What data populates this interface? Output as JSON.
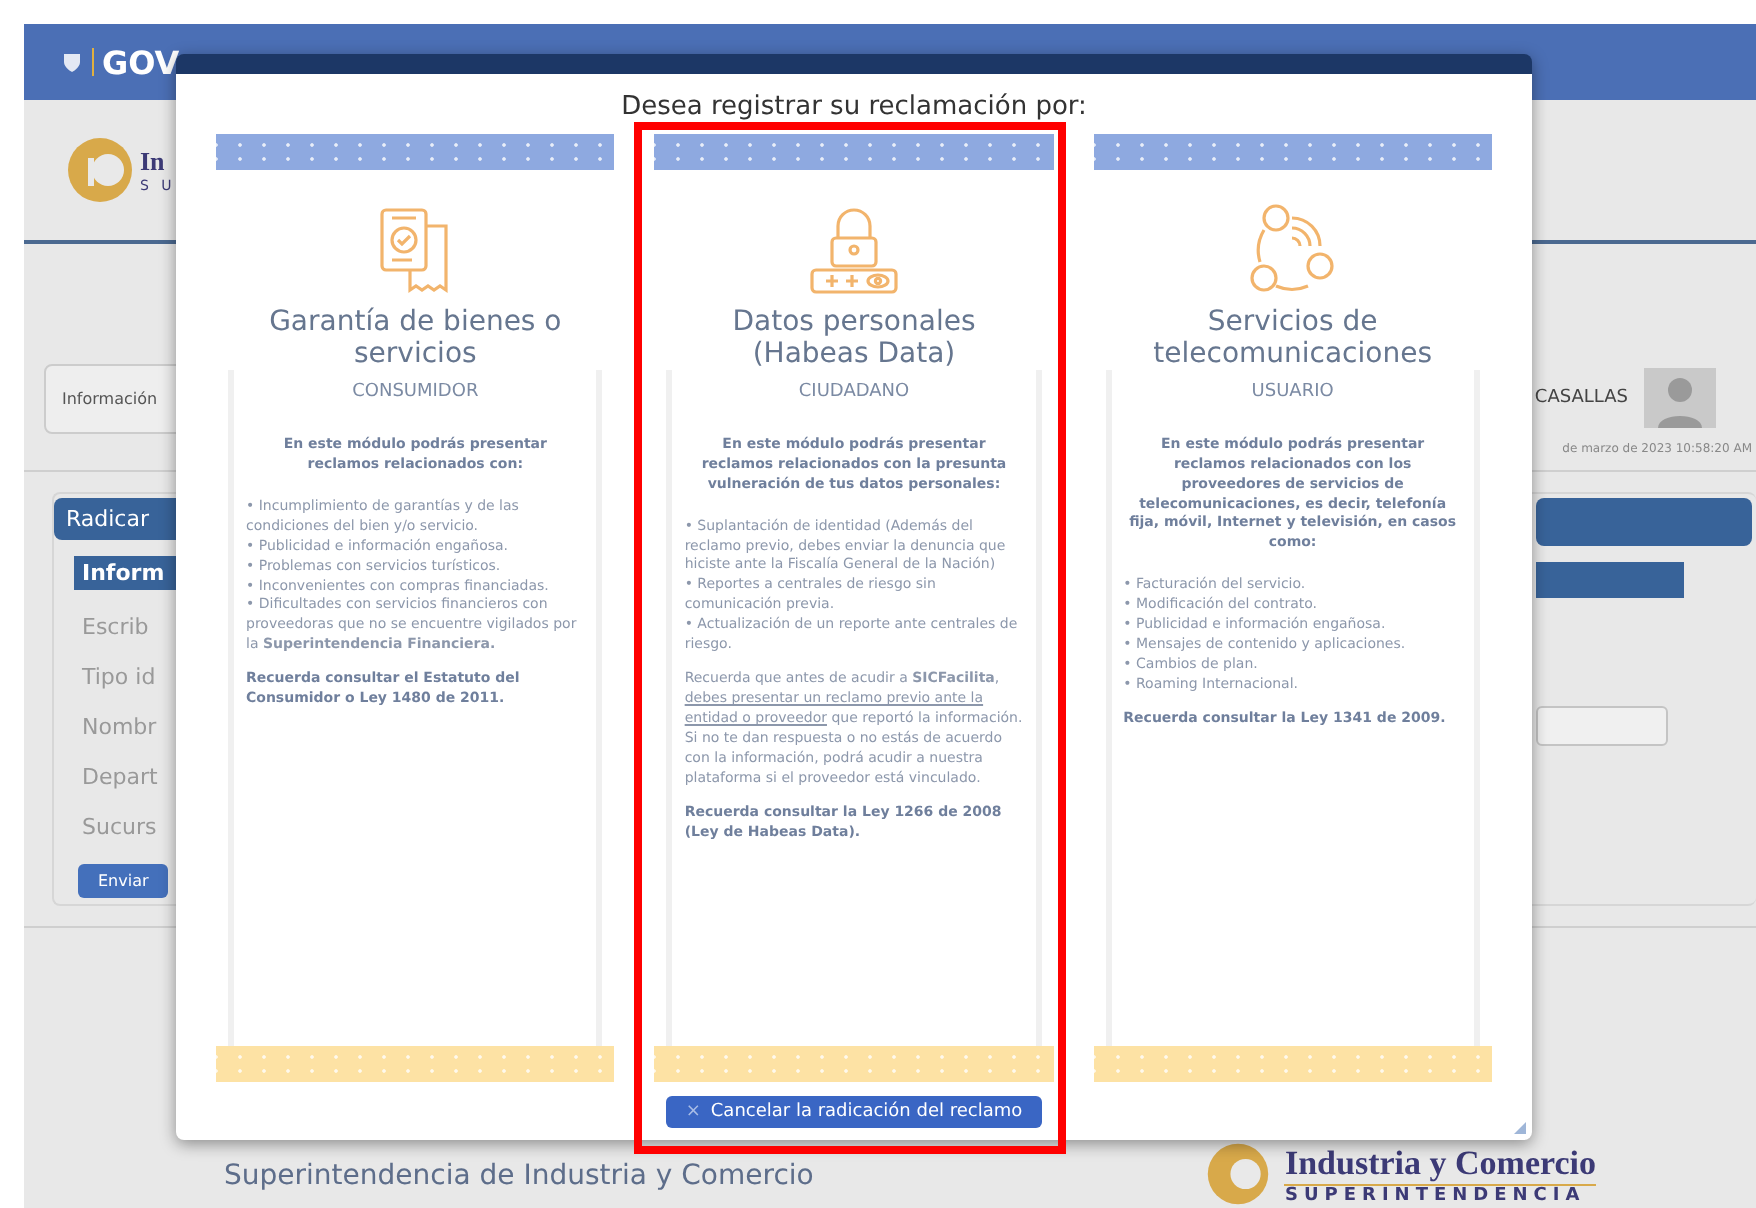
{
  "background": {
    "brand": "GOV",
    "logo": {
      "line1": "In",
      "line2": "S U"
    },
    "info_tab": "Información",
    "user": {
      "name": "CASALLAS",
      "date": "de marzo de 2023 10:58:20 AM"
    },
    "form": {
      "title": "Radicar",
      "section": "Inform",
      "fields": [
        "Escrib",
        "Tipo id",
        "Nombr",
        "Depart",
        "Sucurs"
      ],
      "submit": "Enviar"
    },
    "footer": {
      "text": "Superintendencia de Industria y Comercio",
      "logo_line1": "Industria y Comercio",
      "logo_line2": "SUPERINTENDENCIA"
    }
  },
  "modal": {
    "title": "Desea registrar su reclamación por:",
    "cards": [
      {
        "title": "Garantía de bienes o servicios",
        "role": "CONSUMIDOR",
        "highlighted": false,
        "intro": "En este módulo podrás presentar reclamos relacionados con:",
        "items": [
          "• Incumplimiento de garantías y de las condiciones del bien y/o servicio.",
          "• Publicidad e información engañosa.",
          "• Problemas con servicios turísticos.",
          "• Inconvenientes con compras financiadas.",
          "• Dificultades con servicios financieros con proveedoras que no se encuentre vigilados por la **Superintendencia Financiera.**"
        ],
        "footnote": "Recuerda consultar el Estatuto del Consumidor o Ley 1480 de 2011."
      },
      {
        "title": "Datos personales (Habeas Data)",
        "role": "CIUDADANO",
        "highlighted": true,
        "intro": "En este módulo podrás presentar reclamos relacionados con la presunta vulneración de tus datos personales:",
        "items": [
          "• Suplantación de identidad (Además del reclamo previo, debes enviar la denuncia que hiciste ante la Fiscalía General de la Nación)",
          "• Reportes a centrales de riesgo sin comunicación previa.",
          "• Actualización de un reporte ante centrales de riesgo."
        ],
        "notes": [
          {
            "before": "Recuerda que antes de acudir a **SICFacilita**,",
            "underlined": "debes presentar un reclamo previo ante la entidad o proveedor",
            "after": "que reportó la información. Si no te dan respuesta o no estás de acuerdo con la información, podrá acudir a nuestra plataforma si el proveedor está vinculado."
          }
        ],
        "footnote": "Recuerda consultar la Ley 1266 de 2008 (Ley de Habeas Data)."
      },
      {
        "title": "Servicios de telecomunicaciones",
        "role": "USUARIO",
        "highlighted": false,
        "intro": "En este módulo podrás presentar reclamos relacionados con los proveedores de servicios de telecomunicaciones, es decir, telefonía fija, móvil, Internet y televisión, en casos como:",
        "items": [
          "• Facturación del servicio.",
          "• Modificación del contrato.",
          "• Publicidad e información engañosa.",
          "• Mensajes de contenido y aplicaciones.",
          "• Cambios de plan.",
          "• Roaming Internacional."
        ],
        "footnote": "Recuerda consultar la Ley 1341 de 2009."
      }
    ],
    "cancel_button": {
      "icon": "×",
      "label": "Cancelar la radicación del reclamo"
    }
  }
}
